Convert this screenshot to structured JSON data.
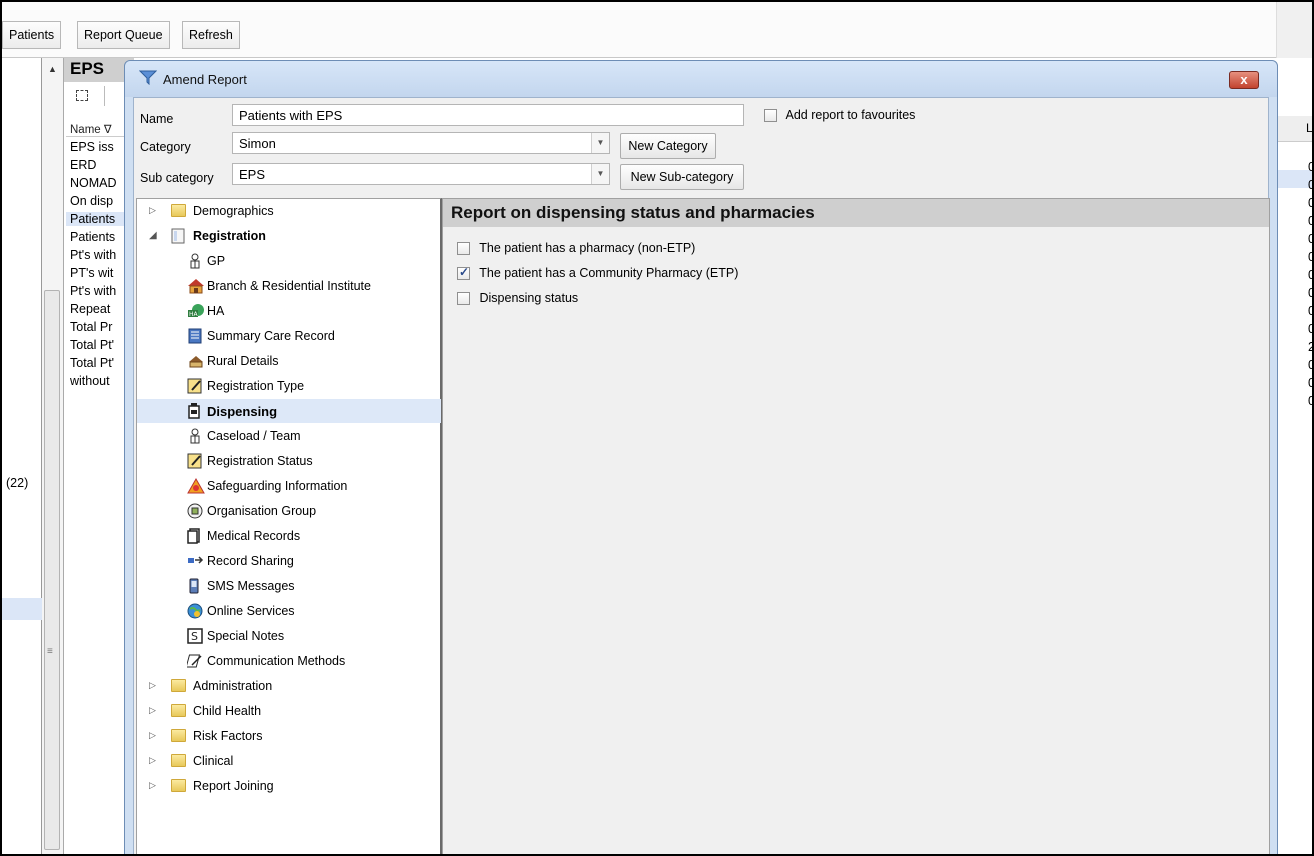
{
  "toolbar": {
    "buttons": [
      "Patients",
      "Report Queue",
      "Refresh"
    ]
  },
  "left_pane": {
    "count": "(22)"
  },
  "background_list": {
    "title": "EPS",
    "column_header": "Name ∇",
    "items": [
      "EPS iss",
      "ERD",
      "NOMAD",
      "On disp",
      "Patients",
      "Patients",
      "Pt's with",
      "PT's wit",
      "Pt's with",
      "Repeat",
      "Total Pr",
      "Total Pt'",
      "Total Pt'",
      "without"
    ],
    "right_column_header": "L",
    "right_values": [
      "0",
      "0",
      "0",
      "0",
      "0",
      "0",
      "0",
      "0",
      "0",
      "0",
      "2",
      "0",
      "0",
      "0"
    ]
  },
  "dialog": {
    "title": "Amend Report",
    "close_label": "x",
    "name_label": "Name",
    "name_value": "Patients with EPS",
    "favourites_label": "Add report to favourites",
    "favourites_checked": false,
    "category_label": "Category",
    "category_value": "Simon",
    "new_category_label": "New Category",
    "subcategory_label": "Sub category",
    "subcategory_value": "EPS",
    "new_subcategory_label": "New Sub-category"
  },
  "tree": {
    "items": [
      {
        "label": "Demographics",
        "level": 0,
        "expanded": false,
        "icon": "folder-icon"
      },
      {
        "label": "Registration",
        "level": 0,
        "expanded": true,
        "icon": "document-icon",
        "bold": true
      },
      {
        "label": "GP",
        "level": 1,
        "icon": "person-icon"
      },
      {
        "label": "Branch & Residential Institute",
        "level": 1,
        "icon": "house-icon"
      },
      {
        "label": "HA",
        "level": 1,
        "icon": "ha-icon"
      },
      {
        "label": "Summary Care Record",
        "level": 1,
        "icon": "record-icon"
      },
      {
        "label": "Rural Details",
        "level": 1,
        "icon": "rural-icon"
      },
      {
        "label": "Registration Type",
        "level": 1,
        "icon": "form-icon"
      },
      {
        "label": "Dispensing",
        "level": 1,
        "icon": "bottle-icon",
        "selected": true,
        "bold": true
      },
      {
        "label": "Caseload / Team",
        "level": 1,
        "icon": "person-icon"
      },
      {
        "label": "Registration Status",
        "level": 1,
        "icon": "form-icon"
      },
      {
        "label": "Safeguarding Information",
        "level": 1,
        "icon": "warning-icon"
      },
      {
        "label": "Organisation Group",
        "level": 1,
        "icon": "organisation-icon"
      },
      {
        "label": "Medical Records",
        "level": 1,
        "icon": "records-icon"
      },
      {
        "label": "Record Sharing",
        "level": 1,
        "icon": "sharing-icon"
      },
      {
        "label": "SMS Messages",
        "level": 1,
        "icon": "phone-icon"
      },
      {
        "label": "Online Services",
        "level": 1,
        "icon": "globe-icon"
      },
      {
        "label": "Special Notes",
        "level": 1,
        "icon": "notes-icon"
      },
      {
        "label": "Communication Methods",
        "level": 1,
        "icon": "pen-icon"
      },
      {
        "label": "Administration",
        "level": 0,
        "expanded": false,
        "icon": "folder-icon"
      },
      {
        "label": "Child Health",
        "level": 0,
        "expanded": false,
        "icon": "folder-icon"
      },
      {
        "label": "Risk Factors",
        "level": 0,
        "expanded": false,
        "icon": "folder-icon"
      },
      {
        "label": "Clinical",
        "level": 0,
        "expanded": false,
        "icon": "folder-icon"
      },
      {
        "label": "Report Joining",
        "level": 0,
        "expanded": false,
        "icon": "folder-icon"
      }
    ]
  },
  "panel": {
    "heading": "Report on dispensing status and pharmacies",
    "options": [
      {
        "label": "The patient has a pharmacy (non-ETP)",
        "checked": false
      },
      {
        "label": "The patient has a Community Pharmacy (ETP)",
        "checked": true
      },
      {
        "label": "Dispensing status",
        "checked": false
      }
    ]
  }
}
